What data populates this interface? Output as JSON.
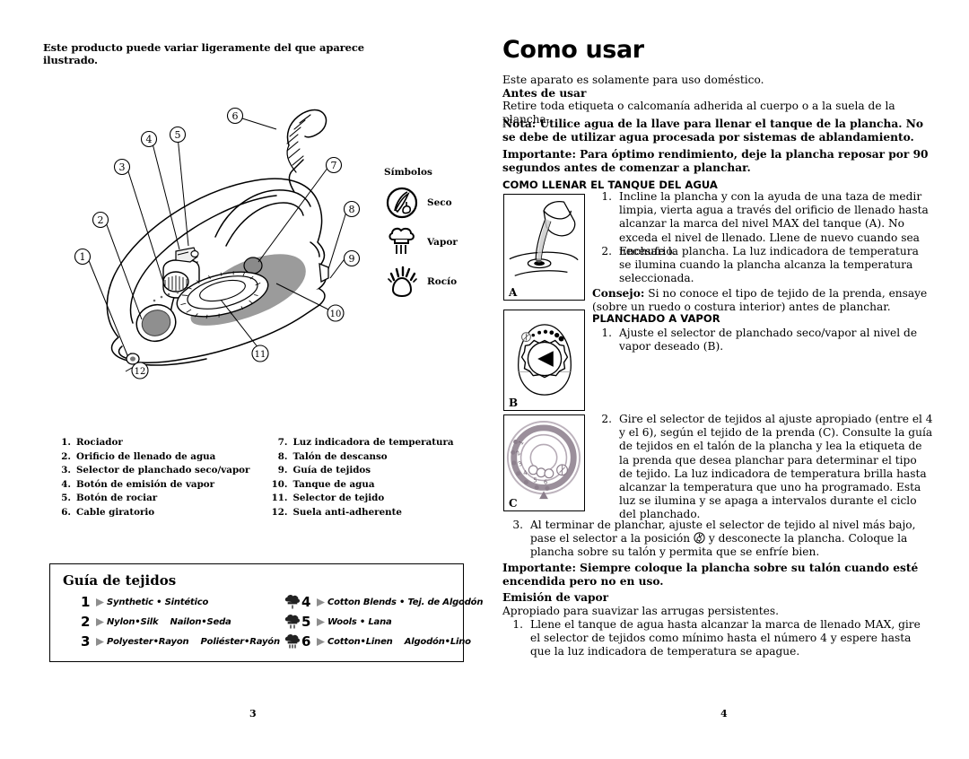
{
  "document": {
    "left_page": {
      "page_number": "3",
      "notice": "Este producto puede variar ligeramente del que aparece ilustrado.",
      "figure": {
        "name": "steam-iron-exploded-diagram",
        "callouts": [
          "1",
          "2",
          "3",
          "4",
          "5",
          "6",
          "7",
          "8",
          "9",
          "10",
          "11",
          "12"
        ]
      },
      "symbols": {
        "title": "Símbolos",
        "items": [
          {
            "icon": "dry-iron-symbol",
            "label": "Seco"
          },
          {
            "icon": "steam-cloud-symbol",
            "label": "Vapor"
          },
          {
            "icon": "spray-mist-symbol",
            "label": "Rocío"
          }
        ]
      },
      "parts_left": [
        {
          "num": "1.",
          "label": "Rociador"
        },
        {
          "num": "2.",
          "label": "Orificio de llenado de agua"
        },
        {
          "num": "3.",
          "label": "Selector de planchado seco/vapor"
        },
        {
          "num": "4.",
          "label": "Botón de emisión de vapor"
        },
        {
          "num": "5.",
          "label": "Botón de rociar"
        },
        {
          "num": "6.",
          "label": "Cable giratorio"
        }
      ],
      "parts_right": [
        {
          "num": "7.",
          "label": "Luz indicadora de temperatura"
        },
        {
          "num": "8.",
          "label": "Talón de descanso"
        },
        {
          "num": "9.",
          "label": "Guía de tejidos"
        },
        {
          "num": "10.",
          "label": "Tanque de agua"
        },
        {
          "num": "11.",
          "label": "Selector de tejido"
        },
        {
          "num": "12.",
          "label": "Suela anti-adherente"
        }
      ],
      "fabric_guide": {
        "title": "Guía de tejidos",
        "rows_left": [
          {
            "steam": "none",
            "num": "1",
            "text": "Synthetic • Sintético"
          },
          {
            "steam": "none",
            "num": "2",
            "text": "Nylon•Silk    Nailon•Seda"
          },
          {
            "steam": "none",
            "num": "3",
            "text": "Polyester•Rayon    Poliéster•Rayón"
          }
        ],
        "rows_right": [
          {
            "steam": "steam-1",
            "num": "4",
            "text": "Cotton Blends • Tej. de Algodón"
          },
          {
            "steam": "steam-2",
            "num": "5",
            "text": "Wools • Lana"
          },
          {
            "steam": "steam-3",
            "num": "6",
            "text": "Cotton•Linen    Algodón•Lino"
          }
        ]
      }
    },
    "right_page": {
      "page_number": "4",
      "title": "Como usar",
      "intro": "Este aparato es solamente para uso doméstico.",
      "antes_heading": "Antes de usar",
      "antes_body": "Retire toda etiqueta o calcomanía adherida al cuerpo o a la suela de la plancha.",
      "nota": "Nota: Utilice agua de la llave para llenar el tanque de la plancha. No se debe de utilizar agua procesada por sistemas de ablandamiento.",
      "importante_1": "Importante: Para óptimo rendimiento, deje la plancha reposar por 90 segundos antes de comenzar a planchar.",
      "section_1_heading": "COMO LLENAR EL TANQUE DEL AGUA",
      "step_1_num": "1.",
      "step_1_text": "Incline la plancha y con la ayuda de una taza de medir limpia, vierta agua a través del orificio de llenado hasta alcanzar la marca del nivel MAX del tanque (A). No exceda el nivel de llenado. Llene de nuevo cuando sea necesario.",
      "step_2_num": "2.",
      "step_2_text": "Enchufe la plancha. La luz indicadora de temperatura se ilumina cuando la plancha alcanza la temperatura seleccionada.",
      "consejo_label": "Consejo:",
      "consejo_text": "Si no conoce el tipo de tejido de la prenda, ensaye (sobre un ruedo o costura interior) antes de planchar.",
      "section_2_heading": "PLANCHADO A VAPOR",
      "step_3_num": "1.",
      "step_3_text": "Ajuste el selector de planchado seco/vapor al nivel de vapor deseado (B).",
      "step_4_num": "2.",
      "step_4_text": "Gire el selector de tejidos al ajuste apropiado (entre el 4 y el 6), según el tejido de la prenda (C). Consulte la guía de tejidos en el talón de la plancha y lea la etiqueta de la prenda que desea planchar para determinar el tipo de tejido. La luz indicadora de temperatura brilla hasta alcanzar la temperatura que uno ha programado. Esta luz se ilumina y se apaga a intervalos durante el ciclo del planchado.",
      "step_5_num": "3.",
      "step_5_text_a": "Al terminar de planchar, ajuste el selector de tejido al nivel más bajo, pase el selector a la posición",
      "step_5_text_b": "y desconecte la plancha. Coloque la plancha sobre su talón y permita que se enfríe bien.",
      "importante_2": "Importante: Siempre coloque la plancha sobre su talón cuando esté encendida pero no en uso.",
      "emision_heading": "Emisión de vapor",
      "emision_body": "Apropiado para suavizar las arrugas persistentes.",
      "step_6_num": "1.",
      "step_6_text": "Llene el tanque de agua hasta alcanzar la marca de llenado MAX, gire el selector de tejidos como mínimo hasta el número 4 y espere hasta que la luz indicadora de temperatura se apague.",
      "figures": [
        {
          "letter": "A",
          "name": "pouring-water-figure"
        },
        {
          "letter": "B",
          "name": "steam-dial-figure"
        },
        {
          "letter": "C",
          "name": "fabric-selector-dial-figure"
        }
      ]
    }
  },
  "colors": {
    "ink": "#000000",
    "paper": "#ffffff",
    "shade_gray": "#9b9b9b",
    "light_gray": "#c9c9c9"
  }
}
